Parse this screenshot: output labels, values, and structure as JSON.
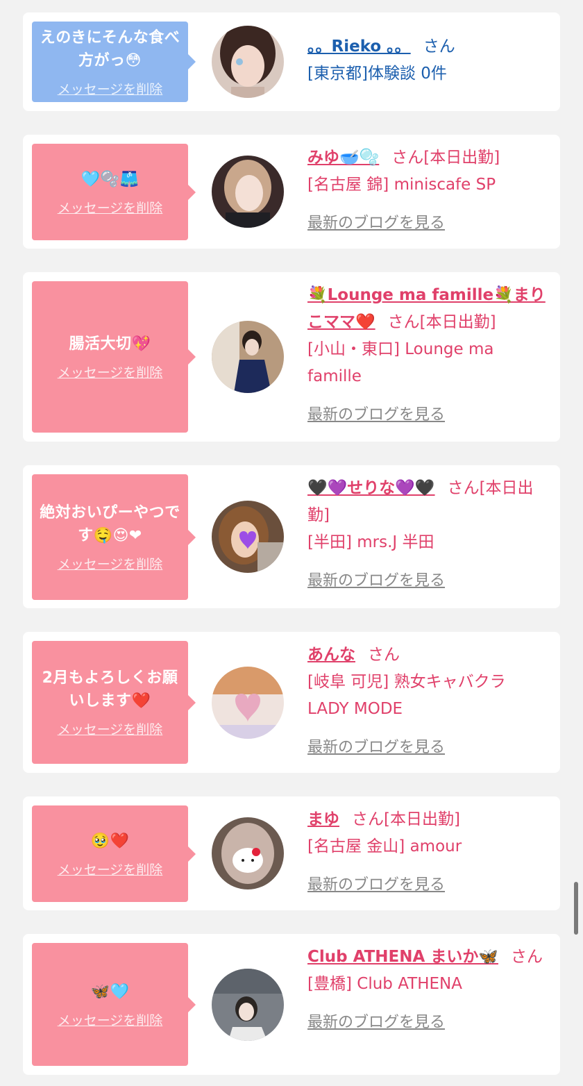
{
  "delete_label": "メッセージを削除",
  "blog_label": "最新のブログを見る",
  "san_label": "さん",
  "cards": [
    {
      "message": "えのきにそんな食べ方がっ😳",
      "name": "。。Rieko 。。",
      "status": "",
      "line1": "[東京都]体験談 0件",
      "line2": ""
    },
    {
      "message": "🩵🫧🩳",
      "name": "みゆ🥣🫧",
      "status": "[本日出勤]",
      "line1": "[名古屋 錦] miniscafe SP",
      "line2": ""
    },
    {
      "message": "腸活大切💖",
      "name": "💐Lounge ma famille💐まりこママ❤️",
      "status": "[本日出勤]",
      "line1": "[小山・東口] Lounge ma famille",
      "line2": ""
    },
    {
      "message": "絶対おいぴーやつです🤤😍❤",
      "name": "🖤💜せりな💜🖤",
      "status": "[本日出勤]",
      "line1": "[半田] mrs.J 半田",
      "line2": ""
    },
    {
      "message": "2月もよろしくお願いします❤️",
      "name": "あんな",
      "status": "",
      "line1": "[岐阜 可児] 熟女キャバクラ LADY MODE",
      "line2": ""
    },
    {
      "message": "🥹❤️",
      "name": "まゆ",
      "status": "[本日出勤]",
      "line1": "[名古屋 金山] amour",
      "line2": ""
    },
    {
      "message": "🦋🩵",
      "name": "Club ATHENA まいか🦋",
      "status": "",
      "line1": "[豊橋] Club ATHENA",
      "line2": ""
    }
  ]
}
